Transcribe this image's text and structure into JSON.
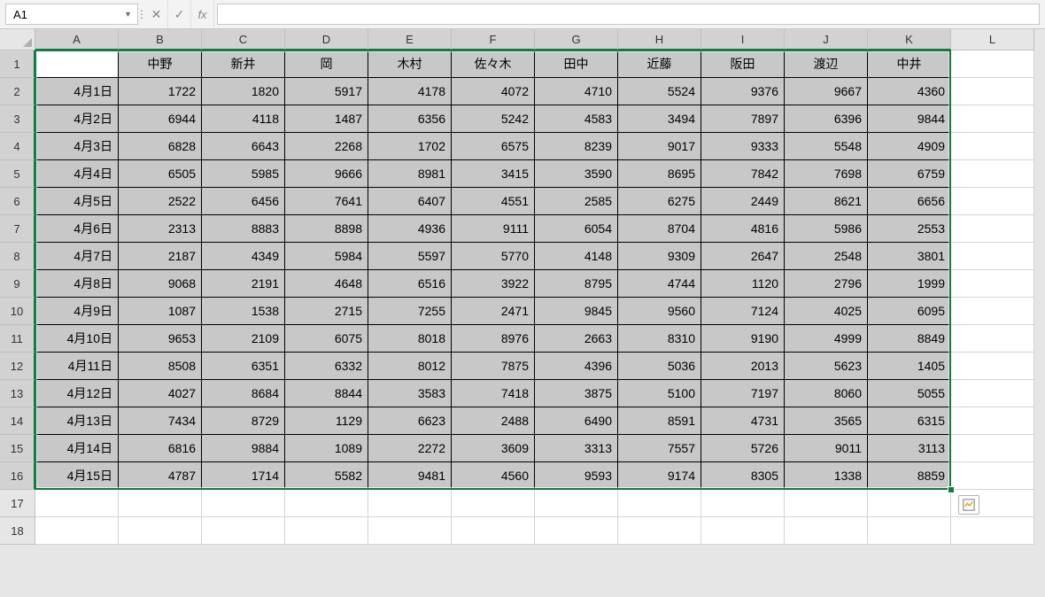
{
  "nameBox": "A1",
  "fx": "fx",
  "formula": "",
  "columns": [
    "A",
    "B",
    "C",
    "D",
    "E",
    "F",
    "G",
    "H",
    "I",
    "J",
    "K",
    "L"
  ],
  "selColumns": [
    "A",
    "B",
    "C",
    "D",
    "E",
    "F",
    "G",
    "H",
    "I",
    "J",
    "K"
  ],
  "rows": [
    "1",
    "2",
    "3",
    "4",
    "5",
    "6",
    "7",
    "8",
    "9",
    "10",
    "11",
    "12",
    "13",
    "14",
    "15",
    "16",
    "17",
    "18"
  ],
  "selRows": [
    "1",
    "2",
    "3",
    "4",
    "5",
    "6",
    "7",
    "8",
    "9",
    "10",
    "11",
    "12",
    "13",
    "14",
    "15",
    "16"
  ],
  "headers": [
    "",
    "中野",
    "新井",
    "岡",
    "木村",
    "佐々木",
    "田中",
    "近藤",
    "阪田",
    "渡辺",
    "中井"
  ],
  "data": [
    [
      "4月1日",
      "1722",
      "1820",
      "5917",
      "4178",
      "4072",
      "4710",
      "5524",
      "9376",
      "9667",
      "4360"
    ],
    [
      "4月2日",
      "6944",
      "4118",
      "1487",
      "6356",
      "5242",
      "4583",
      "3494",
      "7897",
      "6396",
      "9844"
    ],
    [
      "4月3日",
      "6828",
      "6643",
      "2268",
      "1702",
      "6575",
      "8239",
      "9017",
      "9333",
      "5548",
      "4909"
    ],
    [
      "4月4日",
      "6505",
      "5985",
      "9666",
      "8981",
      "3415",
      "3590",
      "8695",
      "7842",
      "7698",
      "6759"
    ],
    [
      "4月5日",
      "2522",
      "6456",
      "7641",
      "6407",
      "4551",
      "2585",
      "6275",
      "2449",
      "8621",
      "6656"
    ],
    [
      "4月6日",
      "2313",
      "8883",
      "8898",
      "4936",
      "9111",
      "6054",
      "8704",
      "4816",
      "5986",
      "2553"
    ],
    [
      "4月7日",
      "2187",
      "4349",
      "5984",
      "5597",
      "5770",
      "4148",
      "9309",
      "2647",
      "2548",
      "3801"
    ],
    [
      "4月8日",
      "9068",
      "2191",
      "4648",
      "6516",
      "3922",
      "8795",
      "4744",
      "1120",
      "2796",
      "1999"
    ],
    [
      "4月9日",
      "1087",
      "1538",
      "2715",
      "7255",
      "2471",
      "9845",
      "9560",
      "7124",
      "4025",
      "6095"
    ],
    [
      "4月10日",
      "9653",
      "2109",
      "6075",
      "8018",
      "8976",
      "2663",
      "8310",
      "9190",
      "4999",
      "8849"
    ],
    [
      "4月11日",
      "8508",
      "6351",
      "6332",
      "8012",
      "7875",
      "4396",
      "5036",
      "2013",
      "5623",
      "1405"
    ],
    [
      "4月12日",
      "4027",
      "8684",
      "8844",
      "3583",
      "7418",
      "3875",
      "5100",
      "7197",
      "8060",
      "5055"
    ],
    [
      "4月13日",
      "7434",
      "8729",
      "1129",
      "6623",
      "2488",
      "6490",
      "8591",
      "4731",
      "3565",
      "6315"
    ],
    [
      "4月14日",
      "6816",
      "9884",
      "1089",
      "2272",
      "3609",
      "3313",
      "7557",
      "5726",
      "9011",
      "3113"
    ],
    [
      "4月15日",
      "4787",
      "1714",
      "5582",
      "9481",
      "4560",
      "9593",
      "9174",
      "8305",
      "1338",
      "8859"
    ]
  ]
}
